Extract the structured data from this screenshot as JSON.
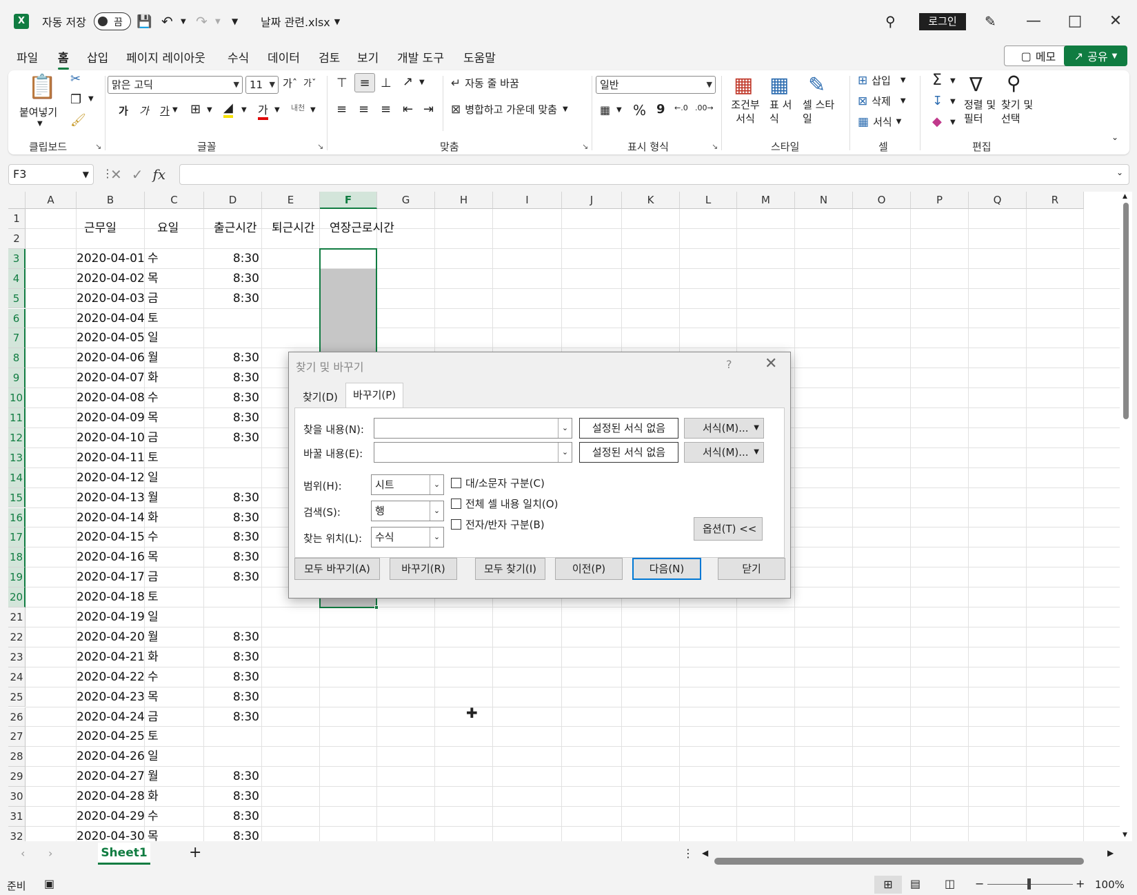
{
  "titlebar": {
    "autosave_label": "자동 저장",
    "autosave_state": "끔",
    "filename": "날짜 관련.xlsx",
    "login": "로그인"
  },
  "menu": {
    "tabs": [
      "파일",
      "홈",
      "삽입",
      "페이지 레이아웃",
      "수식",
      "데이터",
      "검토",
      "보기",
      "개발 도구",
      "도움말"
    ],
    "active": "홈",
    "memo": "메모",
    "share": "공유"
  },
  "ribbon": {
    "clipboard": {
      "label": "클립보드",
      "paste": "붙여넣기"
    },
    "font": {
      "label": "글꼴",
      "font_name": "맑은 고딕",
      "font_size": "11"
    },
    "alignment": {
      "label": "맞춤",
      "wrap": "자동 줄 바꿈",
      "merge": "병합하고 가운데 맞춤"
    },
    "number": {
      "label": "표시 형식",
      "format": "일반"
    },
    "styles": {
      "label": "스타일",
      "conditional": "조건부 서식",
      "table": "표 서식",
      "cell": "셀 스타일"
    },
    "cells": {
      "label": "셀",
      "insert": "삽입",
      "delete": "삭제",
      "format": "서식"
    },
    "editing": {
      "label": "편집",
      "sort": "정렬 및 필터",
      "find": "찾기 및 선택"
    }
  },
  "formula_bar": {
    "name_box": "F3",
    "formula": ""
  },
  "sheet": {
    "columns": [
      "A",
      "B",
      "C",
      "D",
      "E",
      "F",
      "G",
      "H",
      "I",
      "J",
      "K",
      "L",
      "M",
      "N",
      "O",
      "P",
      "Q",
      "R"
    ],
    "selected_column": "F",
    "headers": {
      "B": "근무일",
      "C": "요일",
      "D": "출근시간",
      "E": "퇴근시간",
      "F": "연장근로시간"
    },
    "rows": [
      [
        "2020-04-01",
        "수",
        "8:30"
      ],
      [
        "2020-04-02",
        "목",
        "8:30"
      ],
      [
        "2020-04-03",
        "금",
        "8:30"
      ],
      [
        "2020-04-04",
        "토",
        ""
      ],
      [
        "2020-04-05",
        "일",
        ""
      ],
      [
        "2020-04-06",
        "월",
        "8:30"
      ],
      [
        "2020-04-07",
        "화",
        "8:30"
      ],
      [
        "2020-04-08",
        "수",
        "8:30"
      ],
      [
        "2020-04-09",
        "목",
        "8:30"
      ],
      [
        "2020-04-10",
        "금",
        "8:30"
      ],
      [
        "2020-04-11",
        "토",
        ""
      ],
      [
        "2020-04-12",
        "일",
        ""
      ],
      [
        "2020-04-13",
        "월",
        "8:30"
      ],
      [
        "2020-04-14",
        "화",
        "8:30"
      ],
      [
        "2020-04-15",
        "수",
        "8:30"
      ],
      [
        "2020-04-16",
        "목",
        "8:30"
      ],
      [
        "2020-04-17",
        "금",
        "8:30"
      ],
      [
        "2020-04-18",
        "토",
        ""
      ],
      [
        "2020-04-19",
        "일",
        ""
      ],
      [
        "2020-04-20",
        "월",
        "8:30"
      ],
      [
        "2020-04-21",
        "화",
        "8:30"
      ],
      [
        "2020-04-22",
        "수",
        "8:30"
      ],
      [
        "2020-04-23",
        "목",
        "8:30"
      ],
      [
        "2020-04-24",
        "금",
        "8:30"
      ],
      [
        "2020-04-25",
        "토",
        ""
      ],
      [
        "2020-04-26",
        "일",
        ""
      ],
      [
        "2020-04-27",
        "월",
        "8:30"
      ],
      [
        "2020-04-28",
        "화",
        "8:30"
      ],
      [
        "2020-04-29",
        "수",
        "8:30"
      ],
      [
        "2020-04-30",
        "목",
        "8:30"
      ]
    ],
    "tab_name": "Sheet1"
  },
  "status": {
    "ready": "준비",
    "zoom": "100%"
  },
  "dialog": {
    "title": "찾기 및 바꾸기",
    "help": "?",
    "tabs": [
      "찾기(D)",
      "바꾸기(P)"
    ],
    "active_tab": "바꾸기(P)",
    "find_label": "찾을 내용(N):",
    "find_value": "",
    "replace_label": "바꿀 내용(E):",
    "replace_value": "",
    "no_format": "설정된 서식 없음",
    "format_btn": "서식(M)...",
    "within_label": "범위(H):",
    "within_value": "시트",
    "search_label": "검색(S):",
    "search_value": "행",
    "lookin_label": "찾는 위치(L):",
    "lookin_value": "수식",
    "match_case": "대/소문자 구분(C)",
    "match_entire": "전체 셀 내용 일치(O)",
    "match_byte": "전자/반자 구분(B)",
    "options_btn": "옵션(T) <<",
    "buttons": [
      "모두 바꾸기(A)",
      "바꾸기(R)",
      "모두 찾기(I)",
      "이전(P)",
      "다음(N)",
      "닫기"
    ]
  }
}
